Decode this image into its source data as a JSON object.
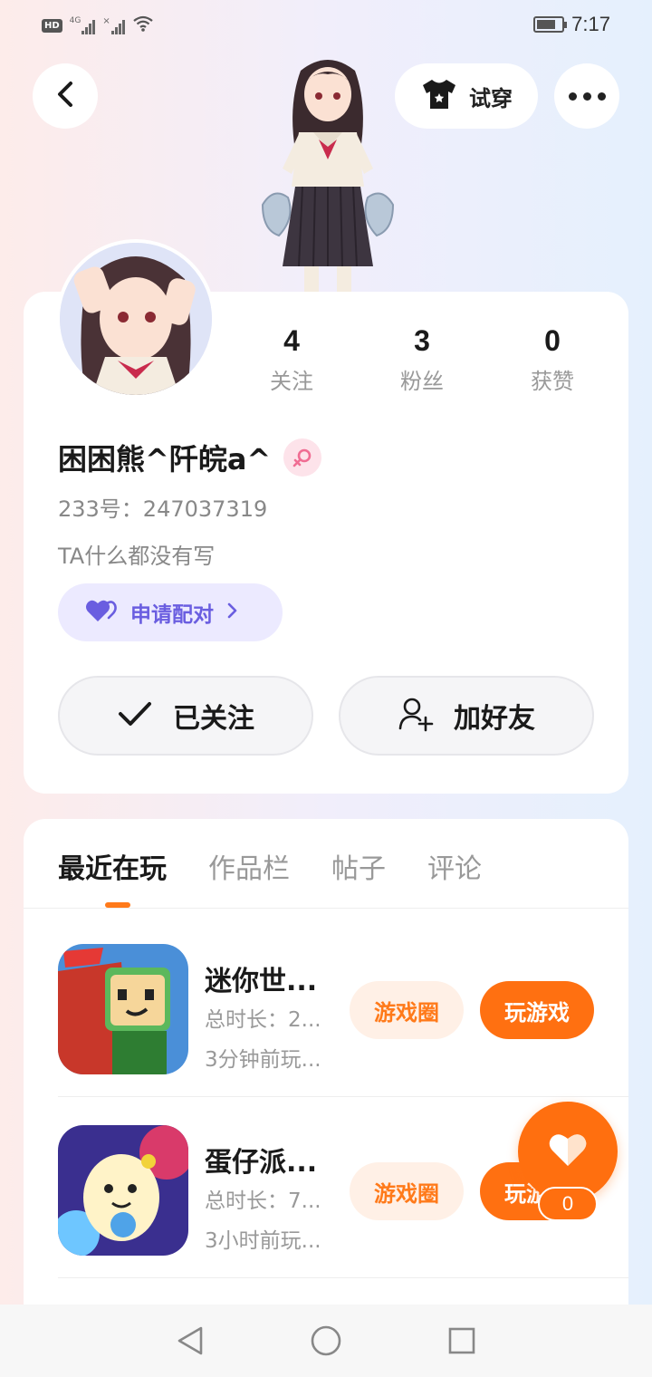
{
  "status_bar": {
    "hd": "HD",
    "network": "4G",
    "time": "7:17",
    "battery_level": 0.75
  },
  "header": {
    "try_on_label": "试穿"
  },
  "profile": {
    "stats": [
      {
        "value": "4",
        "label": "关注"
      },
      {
        "value": "3",
        "label": "粉丝"
      },
      {
        "value": "0",
        "label": "获赞"
      }
    ],
    "nickname": "困困熊^阡皖a^",
    "gender": "female",
    "uid": "233号：247037319",
    "bio": "TA什么都没有写",
    "pair_label": "申请配对",
    "followed_label": "已关注",
    "add_friend_label": "加好友"
  },
  "tabs": [
    {
      "label": "最近在玩",
      "active": true
    },
    {
      "label": "作品栏",
      "active": false
    },
    {
      "label": "帖子",
      "active": false
    },
    {
      "label": "评论",
      "active": false
    }
  ],
  "games": [
    {
      "name": "迷你世...",
      "duration": "总时长：2...",
      "last_played": "3分钟前玩...",
      "circle_label": "游戏圈",
      "play_label": "玩游戏"
    },
    {
      "name": "蛋仔派...",
      "duration": "总时长：7...",
      "last_played": "3小时前玩...",
      "circle_label": "游戏圈",
      "play_label": "玩游戏"
    }
  ],
  "floating_like": {
    "count": "0"
  },
  "colors": {
    "accent_orange": "#ff7011",
    "pair_purple": "#6a5ee0",
    "gender_pink": "#f06d93"
  }
}
